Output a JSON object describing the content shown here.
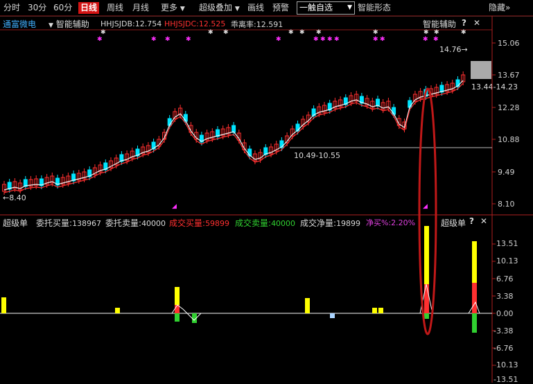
{
  "toolbar": {
    "tabs": [
      "分时",
      "30分",
      "60分",
      "日线",
      "周线",
      "月线"
    ],
    "active_tab": "日线",
    "more_label": "更多",
    "super_overlay_label": "超级叠加",
    "draw_line_label": "画线",
    "alert_label": "预警",
    "watchlist_value": "一触自选",
    "smart_pattern_label": "智能形态",
    "hide_label": "隐藏"
  },
  "main_panel": {
    "stock_name": "通富微电",
    "assist_label": "智能辅助",
    "indicators": [
      {
        "name": "HHJSJDB",
        "value": "12.754",
        "color": "#d8d8d8"
      },
      {
        "name": "HHJSJDC",
        "value": "12.525",
        "color": "#ff3030"
      },
      {
        "name": "乖离率",
        "value": "12.591",
        "color": "#d8d8d8"
      }
    ],
    "right_assist_label": "智能辅助",
    "y_ticks": [
      "15.06",
      "13.67",
      "12.28",
      "10.88",
      "9.49",
      "8.10"
    ],
    "high_label": "14.76",
    "range_label_right": "13.44-14.23",
    "range_label_mid": "10.49-10.55",
    "low_label": "8.40"
  },
  "sub_panel": {
    "title": "超级单",
    "fields": [
      {
        "label": "委托买量",
        "value": "138967",
        "color": "#d8d8d8"
      },
      {
        "label": "委托卖量",
        "value": "40000",
        "color": "#d8d8d8"
      },
      {
        "label": "成交买量",
        "value": "59899",
        "color": "#ff3030"
      },
      {
        "label": "成交卖量",
        "value": "40000",
        "color": "#30d030"
      },
      {
        "label": "成交净量",
        "value": "19899",
        "color": "#d8d8d8"
      },
      {
        "label": "净买%",
        "value": "2.20%",
        "color": "#e040e0"
      }
    ],
    "right_title": "超级单",
    "y_ticks": [
      "13.51",
      "10.13",
      "6.76",
      "3.38",
      "0.00",
      "-3.38",
      "-6.76",
      "-10.13",
      "-13.51"
    ]
  },
  "colors": {
    "up": "#ff3030",
    "down": "#00e5ff",
    "yellow": "#ffff00",
    "green": "#30d030",
    "highlight": "#c01818"
  },
  "icons": [
    "dropdown-icon",
    "question-icon",
    "close-icon",
    "left-arrow-icon",
    "right-arrow-icon"
  ]
}
